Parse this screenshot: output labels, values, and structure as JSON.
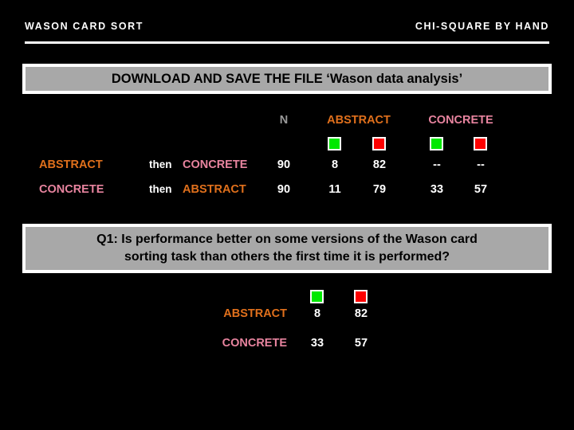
{
  "header": {
    "left_title": "WASON CARD SORT",
    "right_title": "CHI-SQUARE BY HAND"
  },
  "download_banner": {
    "text": "DOWNLOAD AND SAVE THE FILE ‘Wason data analysis’"
  },
  "table1": {
    "headers": {
      "n": "N",
      "abstract": "ABSTRACT",
      "concrete": "CONCRETE"
    },
    "swatch_labels": {
      "green": "green-swatch",
      "red": "red-swatch"
    },
    "connector": "then",
    "rows": [
      {
        "label": "ABSTRACT",
        "connector": "then",
        "target": "CONCRETE",
        "n": "90",
        "abstract_green": "8",
        "abstract_red": "82",
        "concrete_green": "--",
        "concrete_red": "--"
      },
      {
        "label": "CONCRETE",
        "connector": "then",
        "target": "ABSTRACT",
        "n": "90",
        "abstract_green": "11",
        "abstract_red": "79",
        "concrete_green": "33",
        "concrete_red": "57"
      }
    ]
  },
  "question_banner": {
    "line1": "Q1: Is performance better on some versions of the Wason card",
    "line2": "sorting task than others the first time it is performed?"
  },
  "table2": {
    "rows": [
      {
        "label": "ABSTRACT",
        "green": "8",
        "red": "82"
      },
      {
        "label": "CONCRETE",
        "green": "33",
        "red": "57"
      }
    ]
  },
  "colors": {
    "background": "#000000",
    "banner_fill": "#a8a8a8",
    "banner_border": "#ffffff",
    "abstract_text": "#e0701c",
    "concrete_text": "#e8849f",
    "n_text": "#9a9a9a",
    "green_swatch": "#00e800",
    "red_swatch": "#fc0000",
    "body_text": "#ffffff"
  }
}
